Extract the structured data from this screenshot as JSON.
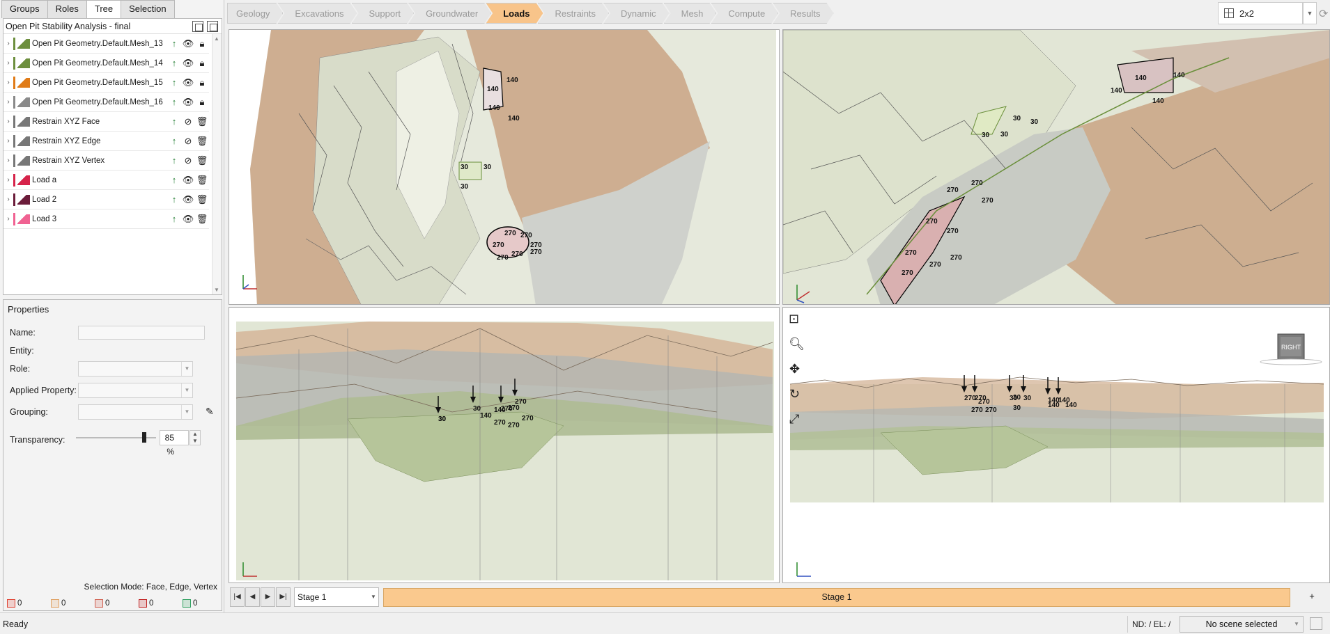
{
  "left_tabs": [
    "Groups",
    "Roles",
    "Tree",
    "Selection"
  ],
  "tree": {
    "title": "Open Pit Stability Analysis - final",
    "items": [
      {
        "label": "Open Pit Geometry.Default.Mesh_13",
        "color": "#6d8f3e",
        "icon": "mesh-icon",
        "actions": [
          "pin",
          "eye",
          "lock"
        ]
      },
      {
        "label": "Open Pit Geometry.Default.Mesh_14",
        "color": "#6d8f3e",
        "icon": "mesh-icon",
        "actions": [
          "pin",
          "eye",
          "lock"
        ]
      },
      {
        "label": "Open Pit Geometry.Default.Mesh_15",
        "color": "#e07b18",
        "icon": "mesh-icon",
        "actions": [
          "pin",
          "eye",
          "lock"
        ]
      },
      {
        "label": "Open Pit Geometry.Default.Mesh_16",
        "color": "#8a8a8a",
        "icon": "mesh-icon",
        "actions": [
          "pin",
          "eye",
          "lock"
        ]
      },
      {
        "label": "Restrain XYZ Face",
        "color": "#777777",
        "icon": "restraint-icon",
        "actions": [
          "pin",
          "eye-hidden",
          "delete"
        ]
      },
      {
        "label": "Restrain XYZ Edge",
        "color": "#777777",
        "icon": "restraint-icon",
        "actions": [
          "pin",
          "eye-hidden",
          "delete"
        ]
      },
      {
        "label": "Restrain XYZ Vertex",
        "color": "#777777",
        "icon": "restraint-icon",
        "actions": [
          "pin",
          "eye-hidden",
          "delete"
        ]
      },
      {
        "label": "Load a",
        "color": "#d6234a",
        "icon": "load-icon",
        "actions": [
          "pin",
          "eye",
          "delete"
        ]
      },
      {
        "label": "Load 2",
        "color": "#6b1c3a",
        "icon": "load-icon",
        "actions": [
          "pin",
          "eye",
          "delete"
        ]
      },
      {
        "label": "Load 3",
        "color": "#f06292",
        "icon": "load-icon",
        "actions": [
          "pin",
          "eye",
          "delete"
        ]
      }
    ]
  },
  "properties": {
    "title": "Properties",
    "name_label": "Name:",
    "entity_label": "Entity:",
    "role_label": "Role:",
    "applied_label": "Applied Property:",
    "grouping_label": "Grouping:",
    "transparency_label": "Transparency:",
    "transparency_value": "85 %",
    "transparency_fraction": 0.85,
    "selection_mode": "Selection Mode:  Face, Edge, Vertex"
  },
  "counts": [
    {
      "value": "0",
      "color": "#e04030"
    },
    {
      "value": "0",
      "color": "#e0a060"
    },
    {
      "value": "0",
      "color": "#d06050"
    },
    {
      "value": "0",
      "color": "#c02020"
    },
    {
      "value": "0",
      "color": "#30a060"
    }
  ],
  "workflow": {
    "steps": [
      "Geology",
      "Excavations",
      "Support",
      "Groundwater",
      "Loads",
      "Restraints",
      "Dynamic",
      "Mesh",
      "Compute",
      "Results"
    ],
    "active": "Loads"
  },
  "layout_selector": "2x2",
  "viewcube_label": "RIGHT",
  "stage": {
    "selected": "Stage 1",
    "bar_label": "Stage 1",
    "add_label": "+"
  },
  "status": {
    "ready": "Ready",
    "nd_el": "ND: /  EL: /",
    "scene": "No scene selected"
  },
  "load_values": {
    "a": "140",
    "b": "30",
    "c": "270"
  },
  "colors": {
    "active_step": "#f8c48a",
    "stage_bar": "#fac98e",
    "rock": "#c9a384",
    "ground": "#dfe4cf",
    "grey": "#b8bab6"
  }
}
